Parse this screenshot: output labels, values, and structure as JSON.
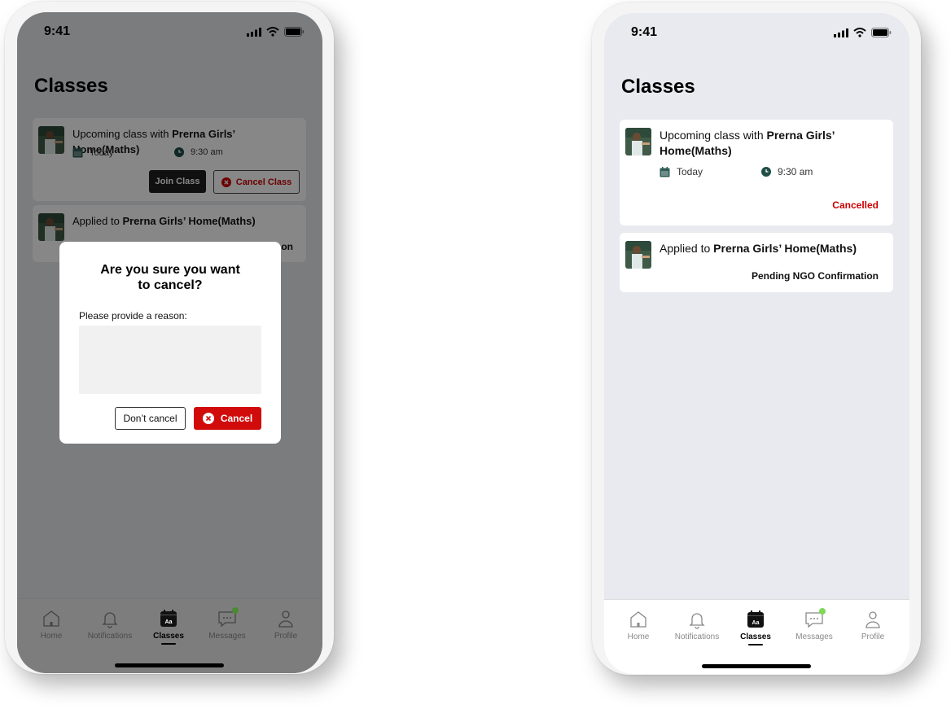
{
  "status_time": "9:41",
  "page_title": "Classes",
  "colors": {
    "accent_red": "#cc0000",
    "button_dark": "#1f1f1f",
    "online_dot": "#7ed957"
  },
  "cards": {
    "upcoming": {
      "prefix": "Upcoming class with ",
      "org": "Prerna Girls’ Home(Maths)",
      "date": "Today",
      "time": "9:30 am",
      "join_label": "Join Class",
      "cancel_label": "Cancel Class",
      "status_cancelled": "Cancelled"
    },
    "applied": {
      "prefix": "Applied to ",
      "org": "Prerna Girls’ Home(Maths)",
      "status": "Pending NGO Confirmation",
      "status_partial": "on"
    }
  },
  "modal": {
    "title_line1": "Are you sure you want",
    "title_line2": "to cancel?",
    "reason_label": "Please provide a reason:",
    "reason_value": "",
    "dont_cancel": "Don’t cancel",
    "cancel": "Cancel"
  },
  "tabs": [
    {
      "label": "Home",
      "icon": "home-icon"
    },
    {
      "label": "Notifications",
      "icon": "bell-icon"
    },
    {
      "label": "Classes",
      "icon": "calendar-icon",
      "active": true
    },
    {
      "label": "Messages",
      "icon": "chat-icon"
    },
    {
      "label": "Profile",
      "icon": "user-icon"
    }
  ]
}
